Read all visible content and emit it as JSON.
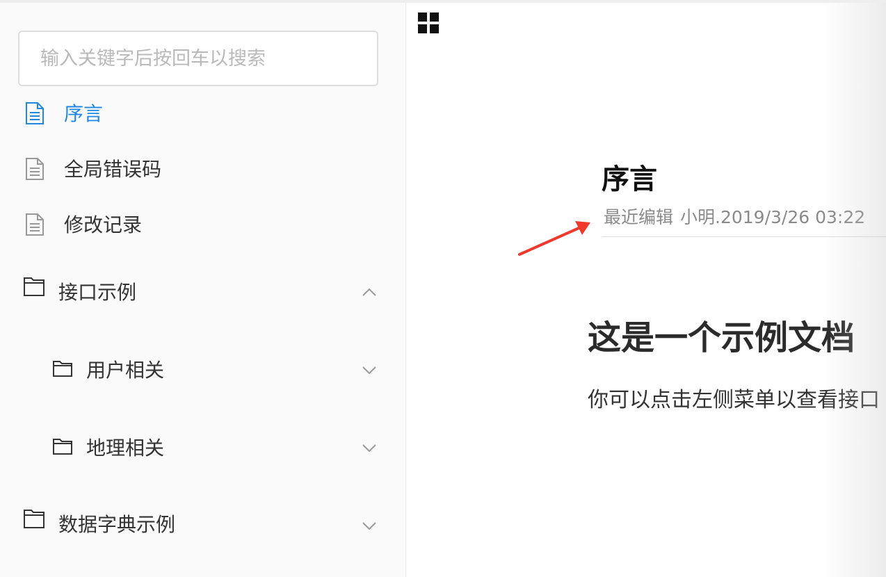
{
  "search": {
    "placeholder": "输入关键字后按回车以搜索"
  },
  "sidebar": {
    "items": [
      {
        "label": "序言",
        "icon": "document-icon",
        "active": true
      },
      {
        "label": "全局错误码",
        "icon": "document-icon"
      },
      {
        "label": "修改记录",
        "icon": "document-icon"
      },
      {
        "label": "接口示例",
        "icon": "folder-icon",
        "expanded": true,
        "children": [
          {
            "label": "用户相关",
            "icon": "folder-icon"
          },
          {
            "label": "地理相关",
            "icon": "folder-icon"
          }
        ]
      },
      {
        "label": "数据字典示例",
        "icon": "folder-icon"
      }
    ]
  },
  "main": {
    "toolbar_icon": "grid-icon",
    "title": "序言",
    "meta": {
      "prefix": "最近编辑",
      "author_time": "小明.2019/3/26 03:22"
    },
    "content": {
      "heading": "这是一个示例文档",
      "paragraph": "你可以点击左侧菜单以查看接口"
    }
  },
  "colors": {
    "accent": "#1e88e5",
    "arrow": "#f03a2e",
    "sidebar_bg": "#fafafa"
  }
}
